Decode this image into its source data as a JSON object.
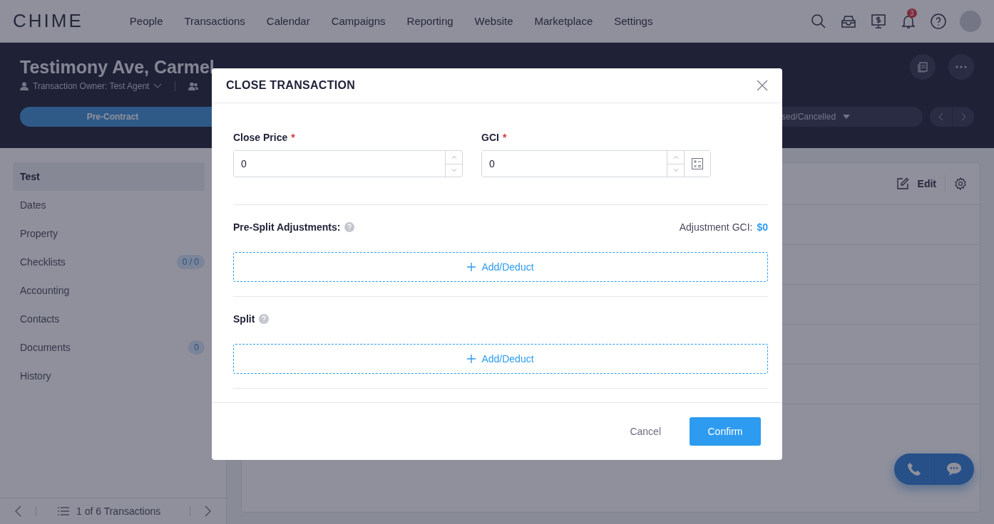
{
  "nav": {
    "logo": "CHIME",
    "items": [
      {
        "label": "People",
        "selected": false
      },
      {
        "label": "Transactions",
        "selected": false
      },
      {
        "label": "Calendar",
        "selected": false
      },
      {
        "label": "Campaigns",
        "selected": false
      },
      {
        "label": "Reporting",
        "selected": false
      },
      {
        "label": "Website",
        "selected": false
      },
      {
        "label": "Marketplace",
        "selected": false
      },
      {
        "label": "Settings",
        "selected": false
      }
    ],
    "notification_count": "3"
  },
  "header": {
    "title": "Testimony Ave, Carmel",
    "owner": "Transaction Owner: Test Agent",
    "stage": "Pre-Contract",
    "status": "sed/Cancelled"
  },
  "sidebar": {
    "items": [
      {
        "label": "Test",
        "selected": true
      },
      {
        "label": "Dates",
        "selected": false
      },
      {
        "label": "Property",
        "selected": false
      },
      {
        "label": "Checklists",
        "selected": false,
        "badge": "0 / 0"
      },
      {
        "label": "Accounting",
        "selected": false
      },
      {
        "label": "Contacts",
        "selected": false
      },
      {
        "label": "Documents",
        "selected": false,
        "badge": "0"
      },
      {
        "label": "History",
        "selected": false
      }
    ],
    "pager": "1 of 6 Transactions"
  },
  "content": {
    "edit": "Edit"
  },
  "dialog": {
    "title": "CLOSE TRANSACTION",
    "fields": [
      {
        "kind": "number",
        "label": "Close Price",
        "required_mark": "*",
        "value": "0"
      },
      {
        "kind": "number_calc",
        "label": "GCI",
        "required_mark": "*",
        "value": "0"
      }
    ],
    "sections": [
      {
        "title": "Pre-Split Adjustments:",
        "summary_label": "Adjustment GCI:",
        "summary_value": "$0",
        "add": "Add/Deduct"
      },
      {
        "title": "Split",
        "add": "Add/Deduct"
      }
    ],
    "buttons": [
      {
        "kind": "secondary",
        "label": "Cancel"
      },
      {
        "kind": "primary",
        "label": "Confirm"
      }
    ]
  }
}
